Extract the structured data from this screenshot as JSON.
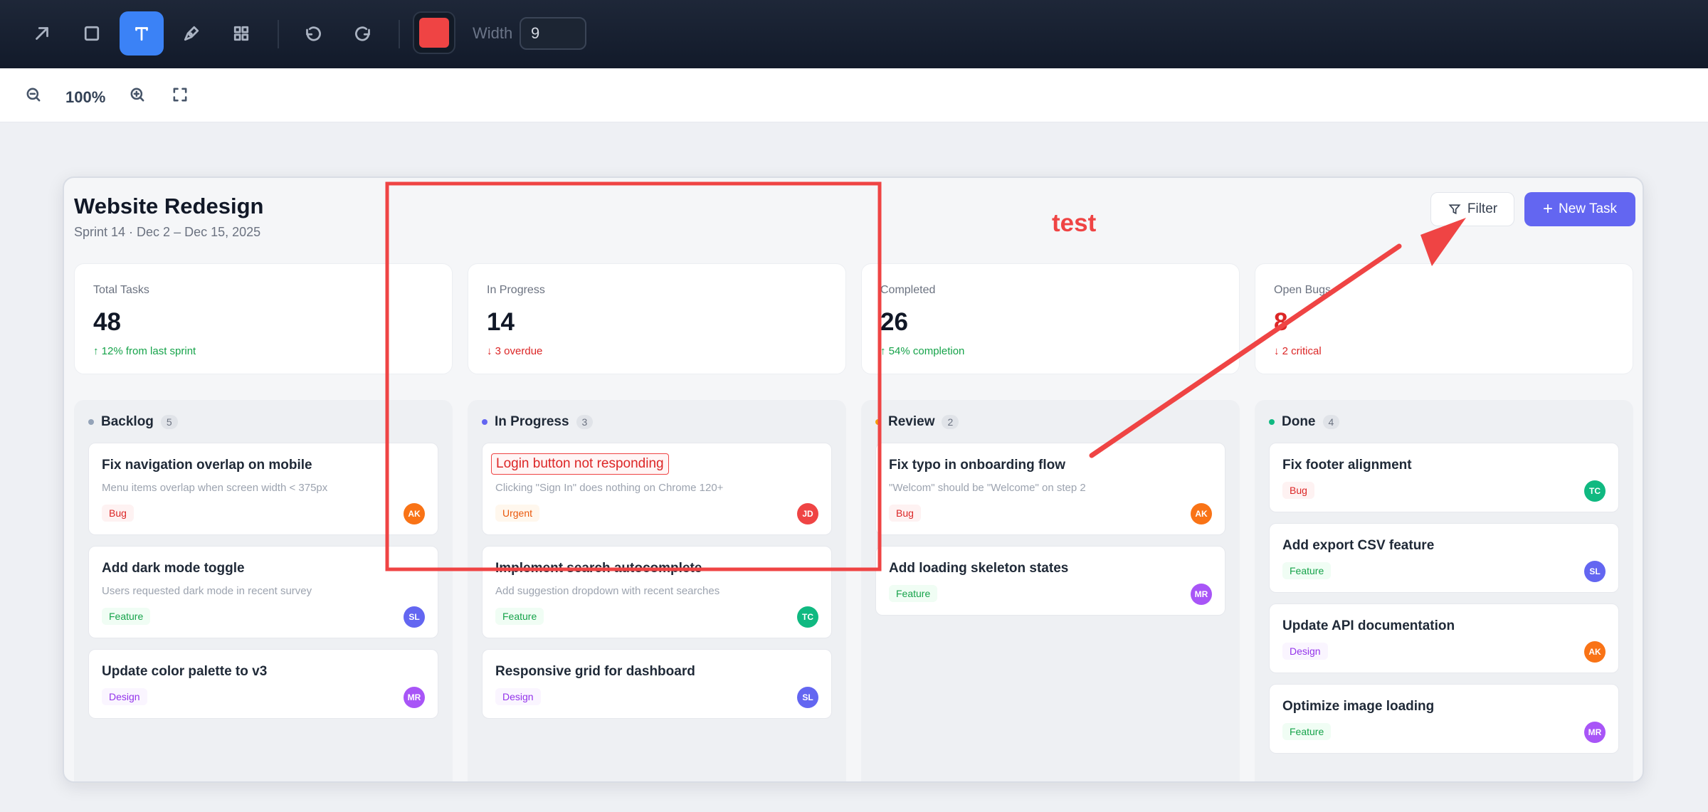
{
  "toolbar": {
    "tools": [
      "arrow-icon",
      "rectangle-icon",
      "text-icon",
      "pen-icon",
      "grid-icon"
    ],
    "active_tool": "text-icon",
    "stroke_color": "#ef4444",
    "width_label": "Width",
    "width_value": "9"
  },
  "zoom": {
    "level": "100%"
  },
  "board": {
    "title": "Website Redesign",
    "subtitle": "Sprint 14 · Dec 2 – Dec 15, 2025",
    "filter_label": "Filter",
    "new_task_label": "New Task",
    "stats": [
      {
        "label": "Total Tasks",
        "value": "48",
        "note": "↑ 12% from last sprint",
        "tone": "green"
      },
      {
        "label": "In Progress",
        "value": "14",
        "note": "↓ 3 overdue",
        "tone": "red"
      },
      {
        "label": "Completed",
        "value": "26",
        "note": "↑ 54% completion",
        "tone": "green"
      },
      {
        "label": "Open Bugs",
        "value": "8",
        "note": "↓ 2 critical",
        "tone": "red"
      }
    ],
    "columns": [
      {
        "name": "Backlog",
        "count": "5",
        "dot": "#94a3b8",
        "cards": [
          {
            "title": "Fix navigation overlap on mobile",
            "desc": "Menu items overlap when screen width < 375px",
            "tag": "Bug",
            "avatar": "AK",
            "avatar_color": "#f97316"
          },
          {
            "title": "Add dark mode toggle",
            "desc": "Users requested dark mode in recent survey",
            "tag": "Feature",
            "avatar": "SL",
            "avatar_color": "#6366f1"
          },
          {
            "title": "Update color palette to v3",
            "tag": "Design",
            "avatar": "MR",
            "avatar_color": "#a855f7"
          }
        ]
      },
      {
        "name": "In Progress",
        "count": "3",
        "dot": "#6366f1",
        "cards": [
          {
            "title": "Login button not responding",
            "desc": "Clicking \"Sign In\" does nothing on Chrome 120+",
            "tag": "Urgent",
            "avatar": "JD",
            "avatar_color": "#ef4444"
          },
          {
            "title": "Implement search autocomplete",
            "desc": "Add suggestion dropdown with recent searches",
            "tag": "Feature",
            "avatar": "TC",
            "avatar_color": "#10b981"
          },
          {
            "title": "Responsive grid for dashboard",
            "tag": "Design",
            "avatar": "SL",
            "avatar_color": "#6366f1"
          }
        ]
      },
      {
        "name": "Review",
        "count": "2",
        "dot": "#f59e0b",
        "cards": [
          {
            "title": "Fix typo in onboarding flow",
            "desc": "\"Welcom\" should be \"Welcome\" on step 2",
            "tag": "Bug",
            "avatar": "AK",
            "avatar_color": "#f97316"
          },
          {
            "title": "Add loading skeleton states",
            "tag": "Feature",
            "avatar": "MR",
            "avatar_color": "#a855f7"
          }
        ]
      },
      {
        "name": "Done",
        "count": "4",
        "dot": "#10b981",
        "cards": [
          {
            "title": "Fix footer alignment",
            "tag": "Bug",
            "avatar": "TC",
            "avatar_color": "#10b981"
          },
          {
            "title": "Add export CSV feature",
            "tag": "Feature",
            "avatar": "SL",
            "avatar_color": "#6366f1"
          },
          {
            "title": "Update API documentation",
            "tag": "Design",
            "avatar": "AK",
            "avatar_color": "#f97316"
          },
          {
            "title": "Optimize image loading",
            "tag": "Feature",
            "avatar": "MR",
            "avatar_color": "#a855f7"
          }
        ]
      }
    ]
  },
  "annotations": {
    "text": "test",
    "color": "#ef4444"
  }
}
